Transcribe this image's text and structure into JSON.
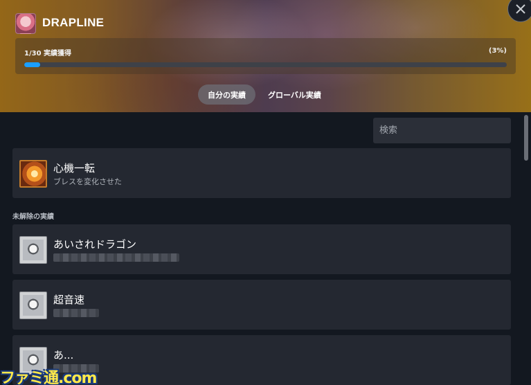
{
  "game": {
    "title": "DRAPLINE",
    "icon": "game-avatar-icon"
  },
  "progress": {
    "label": "1/30 実績獲得",
    "percent_label": "(3%)",
    "fraction": 0.033,
    "fill_color": "#1a9fff"
  },
  "tabs": [
    {
      "label": "自分の実績",
      "active": true
    },
    {
      "label": "グローバル実績",
      "active": false
    }
  ],
  "search": {
    "placeholder": "検索",
    "value": ""
  },
  "unlocked": [
    {
      "name": "心機一転",
      "description": "ブレスを変化させた",
      "icon": "flame-breath-icon"
    }
  ],
  "locked_section_label": "未解除の実績",
  "locked": [
    {
      "name": "あいされドラゴン",
      "icon": "dragon-girl-icon"
    },
    {
      "name": "超音速",
      "icon": "supersonic-icon"
    },
    {
      "name": "あ...",
      "icon": "locked-achievement-icon"
    }
  ],
  "watermark": "ファミ通.com"
}
